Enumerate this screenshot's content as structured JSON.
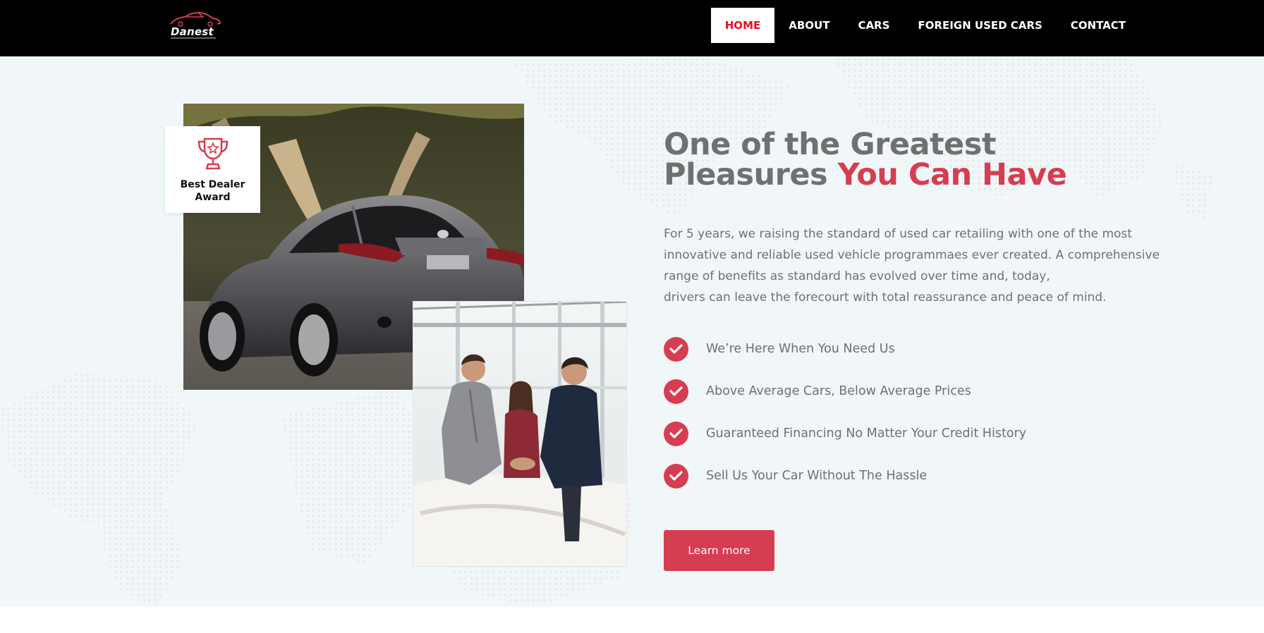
{
  "nav": {
    "logo_text": "Danest",
    "items": [
      {
        "label": "HOME",
        "active": true
      },
      {
        "label": "ABOUT",
        "active": false
      },
      {
        "label": "CARS",
        "active": false
      },
      {
        "label": "FOREIGN USED CARS",
        "active": false
      },
      {
        "label": "CONTACT",
        "active": false
      }
    ]
  },
  "award": {
    "line1": "Best Dealer",
    "line2": "Award",
    "icon": "trophy-icon"
  },
  "hero": {
    "heading_line1": "One of the Greatest",
    "heading_line2_plain": "Pleasures ",
    "heading_line2_accent": "You Can Have",
    "paragraph_lines": [
      "For 5 years, we raising the standard of used car retailing  with one of the most",
      "innovative and reliable used vehicle  programmaes ever created. A comprehensive",
      "range of  benefits as standard has evolved over time and, today,",
      "drivers can leave the forecourt with total reassurance and peace of mind."
    ],
    "features": [
      "We’re Here When You Need Us",
      "Above Average Cars, Below Average Prices",
      "Guaranteed Financing No Matter Your Credit History",
      "Sell Us Your Car Without The Hassle"
    ],
    "button_label": "Learn more"
  },
  "colors": {
    "accent": "#d63d50",
    "nav_active_text": "#e3121e",
    "nav_bg": "#000000",
    "hero_bg": "#f1f6f8",
    "body_text": "#707070"
  }
}
